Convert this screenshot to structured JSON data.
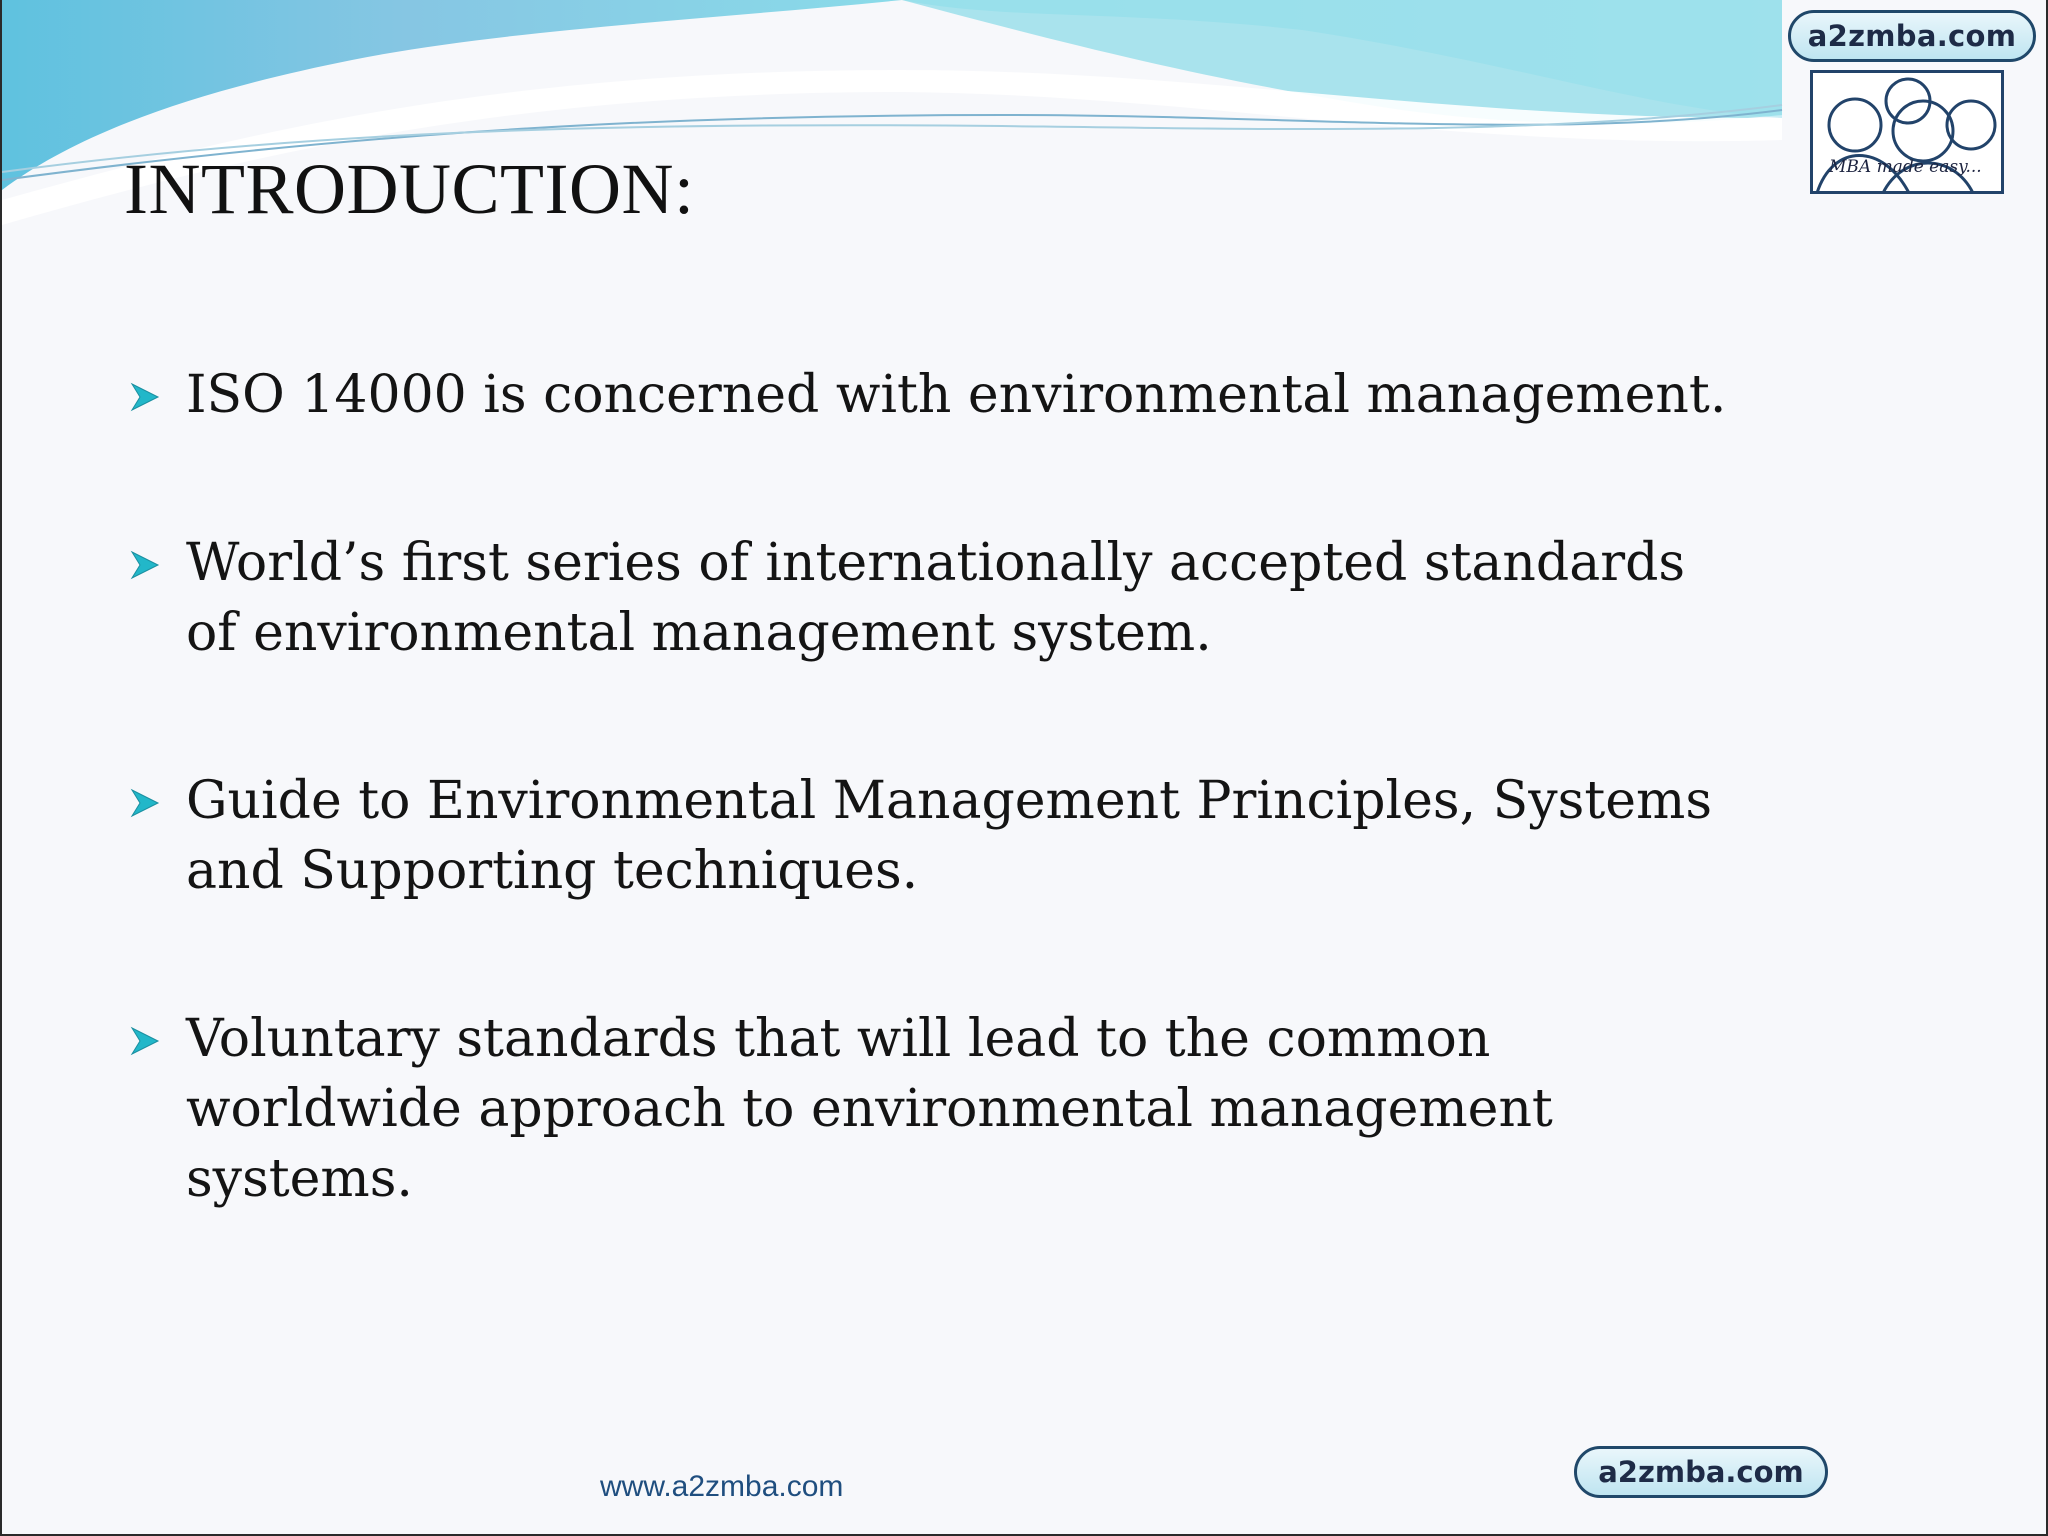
{
  "header": {
    "title": "INTRODUCTION:"
  },
  "logo": {
    "brand": "a2zmba.com",
    "tagline": "MBA made easy..."
  },
  "bullets": [
    {
      "text": "ISO 14000 is concerned with environmental management."
    },
    {
      "text": "World’s first series of internationally accepted standards of environmental management system."
    },
    {
      "text": "Guide to Environmental Management Principles, Systems and Supporting techniques."
    },
    {
      "text": "Voluntary standards that will lead to the common worldwide approach to environmental management systems."
    }
  ],
  "footer": {
    "url": "www.a2zmba.com",
    "brand": "a2zmba.com"
  },
  "colors": {
    "wave_light": "#8fdce8",
    "wave_dark": "#6ab7dc",
    "bullet_arrow": "#22b7c9",
    "footer_link": "#1f4e7f"
  }
}
